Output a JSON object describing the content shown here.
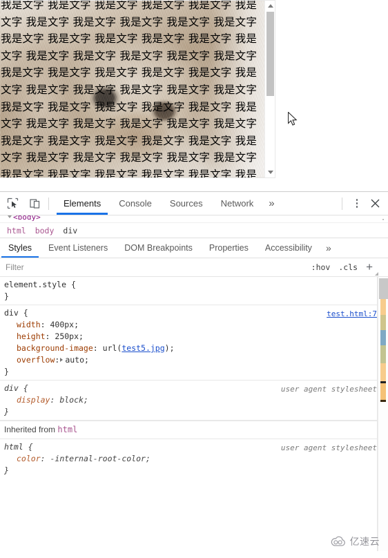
{
  "page": {
    "repeated_text": "我是文字",
    "text_block": "我是文字 我是文字 我是文字 我是文字 我是文字 我是文字 我是文字 我是文字 我是文字 我是文字 我是文字 我是文字 我是文字 我是文字 我是文字 我是文字 我是文字 我是文字 我是文字 我是文字 我是文字 我是文字 我是文字 我是文字 我是文字 我是文字 我是文字 我是文字 我是文字 我是文字 我是文字 我是文字 我是文字 我是文字 我是文字 我是文字 我是文字 我是文字 我是文字 我是文字 我是文字 我是文字 我是文字 我是文字 我是文字 我是文字 我是文字 我是文字 我是文字 我是文字 我是文字 我是文字 我是文字 我是文字 我是文字 我是文字 我是文字 我是文字 我是文字 我是文字 我是文字 我是文字 我是文字 我是文字 我是文字 我是文字 我是文字 我是文字 我是文字"
  },
  "devtools": {
    "toolbar": {
      "inspect_icon": "inspect-element-icon",
      "device_icon": "device-toolbar-icon",
      "tabs": [
        {
          "label": "Elements",
          "active": true
        },
        {
          "label": "Console",
          "active": false
        },
        {
          "label": "Sources",
          "active": false
        },
        {
          "label": "Network",
          "active": false
        }
      ],
      "more_tabs": "»",
      "menu_icon": "more-options-icon",
      "close_icon": "close-icon"
    },
    "dom_tree": {
      "visible_node": "<body>"
    },
    "breadcrumb": [
      "html",
      "body",
      "div"
    ],
    "sub_tabs": [
      {
        "label": "Styles",
        "active": true
      },
      {
        "label": "Event Listeners",
        "active": false
      },
      {
        "label": "DOM Breakpoints",
        "active": false
      },
      {
        "label": "Properties",
        "active": false
      },
      {
        "label": "Accessibility",
        "active": false
      }
    ],
    "sub_tabs_more": "»",
    "filter": {
      "placeholder": "Filter",
      "value": "",
      "hov_label": ":hov",
      "cls_label": ".cls",
      "add_label": "+"
    },
    "styles": {
      "rules": [
        {
          "selector": "element.style",
          "origin": "",
          "origin_type": "none",
          "declarations": []
        },
        {
          "selector": "div",
          "origin": "test.html:7",
          "origin_type": "source",
          "declarations": [
            {
              "prop": "width",
              "value": "400px",
              "link": ""
            },
            {
              "prop": "height",
              "value": "250px",
              "link": ""
            },
            {
              "prop": "background-image",
              "value": "url(test5.jpg);",
              "link": "test5.jpg"
            },
            {
              "prop": "overflow",
              "value": "auto",
              "expandable": true
            }
          ]
        },
        {
          "selector": "div",
          "origin": "user agent stylesheet",
          "origin_type": "ua",
          "declarations": [
            {
              "prop": "display",
              "value": "block"
            }
          ]
        }
      ],
      "inherited_label": "Inherited from",
      "inherited_from": "html",
      "inherited_rules": [
        {
          "selector": "html",
          "origin": "user agent stylesheet",
          "origin_type": "ua",
          "declarations": [
            {
              "prop": "color",
              "value": "-internal-root-color"
            }
          ]
        }
      ]
    },
    "colors": {
      "accent": "#1a73e8",
      "property": "#9c3b00",
      "link": "#1a4ecc",
      "selector_tag": "#a9558f"
    }
  },
  "watermark": {
    "icon": "cloud-icon",
    "text": "亿速云"
  }
}
